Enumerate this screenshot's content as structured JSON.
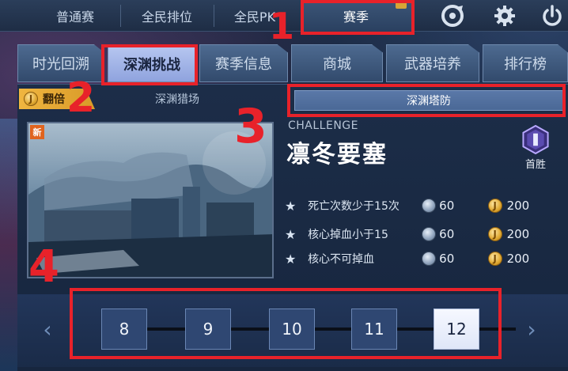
{
  "topnav": {
    "tabs": [
      {
        "label": "普通赛"
      },
      {
        "label": "全民排位"
      },
      {
        "label": "全民PK"
      },
      {
        "label": "赛季"
      }
    ],
    "active_tab": "赛季",
    "icons": [
      "disc-icon",
      "gear-icon",
      "power-icon"
    ]
  },
  "subtabs": [
    {
      "label": "时光回溯"
    },
    {
      "label": "深渊挑战"
    },
    {
      "label": "赛季信息"
    },
    {
      "label": "商城"
    },
    {
      "label": "武器培养"
    },
    {
      "label": "排行榜"
    }
  ],
  "active_subtab": "深渊挑战",
  "modes": {
    "double_label": "翻倍",
    "hunt_label": "深渊猎场",
    "defense_label": "深渊塔防"
  },
  "map": {
    "new_tag": "新",
    "challenge_label": "CHALLENGE",
    "title": "凛冬要塞",
    "first_win_label": "首胜"
  },
  "conditions": [
    {
      "text": "死亡次数少于15次",
      "gem": "60",
      "coin": "200"
    },
    {
      "text": "核心掉血小于15",
      "gem": "60",
      "coin": "200"
    },
    {
      "text": "核心不可掉血",
      "gem": "60",
      "coin": "200"
    }
  ],
  "levels": [
    "8",
    "9",
    "10",
    "11",
    "12"
  ],
  "selected_level": "12",
  "annotations": [
    "1",
    "2",
    "3",
    "4"
  ],
  "colors": {
    "annotation_red": "#e8222a",
    "accent_gold": "#f0b640",
    "active_subtab": "#b6c6f0"
  }
}
